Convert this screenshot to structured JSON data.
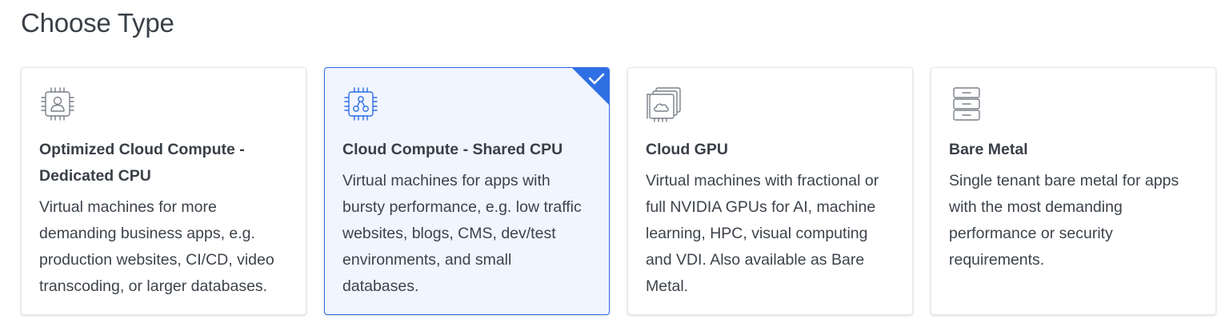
{
  "page": {
    "title": "Choose Type"
  },
  "colors": {
    "accent": "#2f6fe4",
    "selected_bg": "#f0f5ff",
    "text": "#3a3f47",
    "icon_gray": "#7a8089"
  },
  "types": [
    {
      "icon": "cpu-user-icon",
      "title": "Optimized Cloud Compute - Dedicated CPU",
      "description": "Virtual machines for more demanding business apps, e.g. production websites, CI/CD, video transcoding, or larger databases.",
      "selected": false
    },
    {
      "icon": "cpu-share-icon",
      "title": "Cloud Compute - Shared CPU",
      "description": "Virtual machines for apps with bursty performance, e.g. low traffic websites, blogs, CMS, dev/test environments, and small databases.",
      "selected": true
    },
    {
      "icon": "gpu-cards-icon",
      "title": "Cloud GPU",
      "description": "Virtual machines with fractional or full NVIDIA GPUs for AI, machine learning, HPC, visual computing and VDI. Also available as Bare Metal.",
      "selected": false
    },
    {
      "icon": "server-rack-icon",
      "title": "Bare Metal",
      "description": "Single tenant bare metal for apps with the most demanding performance or security requirements.",
      "selected": false
    }
  ]
}
